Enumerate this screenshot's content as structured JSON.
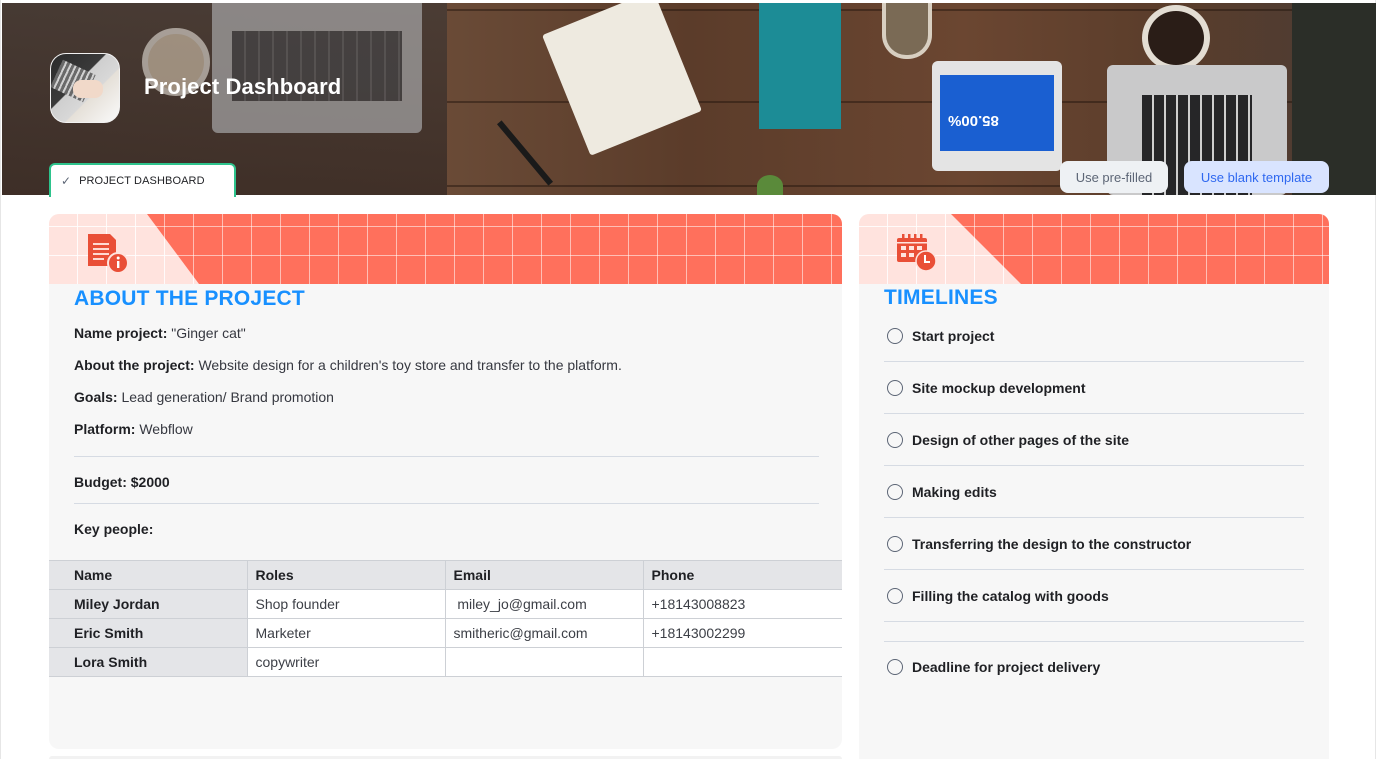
{
  "header": {
    "title": "Project Dashboard",
    "tab_label": "PROJECT DASHBOARD",
    "tab_icon": "check-icon",
    "tablet_text": "85.00%",
    "buttons": {
      "prefilled": "Use pre-filled",
      "blank": "Use blank template"
    }
  },
  "colors": {
    "accent_blue": "#1890ff",
    "coral": "#ff705c",
    "coral_light": "#ffe3de",
    "tab_border": "#2dc38c",
    "blank_btn_bg": "#d9e4ff",
    "blank_btn_text": "#2f68f0"
  },
  "about": {
    "icon": "document-info-icon",
    "title": "ABOUT THE PROJECT",
    "fields": [
      {
        "label": "Name project:",
        "value": " \"Ginger cat\""
      },
      {
        "label": "About the project:",
        "value": "Website design for a children's toy store and transfer to the platform."
      },
      {
        "label": "Goals:",
        "value": "Lead generation/ Brand promotion"
      },
      {
        "label": "Platform:",
        "value": "Webflow"
      }
    ],
    "budget_label": "Budget: $2000",
    "key_people_label": "Key people:",
    "table": {
      "columns": [
        "Name",
        "Roles",
        "Email",
        "Phone"
      ],
      "rows": [
        [
          "Miley Jordan",
          "Shop founder",
          " miley_jo@gmail.com",
          "+18143008823"
        ],
        [
          "Eric Smith",
          "Marketer",
          "smitheric@gmail.com",
          "+18143002299"
        ],
        [
          "Lora Smith",
          "copywriter",
          "",
          ""
        ]
      ]
    }
  },
  "timelines": {
    "icon": "calendar-clock-icon",
    "title": "TIMELINES",
    "items": [
      {
        "label": "Start project",
        "checked": false
      },
      {
        "label": "Site mockup development",
        "checked": false
      },
      {
        "label": "Design of other pages of the site",
        "checked": false
      },
      {
        "label": "Making edits",
        "checked": false
      },
      {
        "label": "Transferring the design to the constructor",
        "checked": false
      },
      {
        "label": "Filling the catalog with goods",
        "checked": false
      }
    ],
    "deadline": {
      "label": "Deadline for project delivery",
      "checked": false
    }
  }
}
